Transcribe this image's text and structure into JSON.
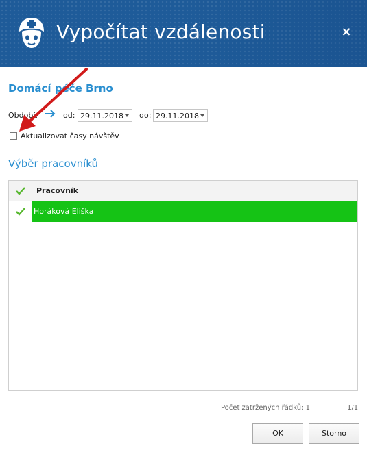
{
  "window": {
    "title": "Vypočítat vzdálenosti",
    "close_glyph": "×"
  },
  "organization": "Domácí péče Brno",
  "period": {
    "label": "Období:",
    "from_label": "od:",
    "from_value": "29.11.2018",
    "to_label": "do:",
    "to_value": "29.11.2018"
  },
  "update_visits": {
    "label": "Aktualizovat časy návštěv",
    "checked": false
  },
  "workers": {
    "section_title": "Výběr pracovníků",
    "column_header": "Pracovník",
    "rows": [
      {
        "name": "Horáková Eliška",
        "checked": true
      }
    ]
  },
  "footer": {
    "checked_rows": "Počet zatržených řádků: 1",
    "page": "1/1"
  },
  "buttons": {
    "ok": "OK",
    "cancel": "Storno"
  },
  "colors": {
    "header_bg": "#1e5b99",
    "accent": "#2a8fd0",
    "selected_row": "#15c315",
    "check": "#58b830",
    "annotation_arrow": "#d11a1a"
  },
  "icons": {
    "app": "nurse-icon",
    "period_arrow": "arrow-right-icon",
    "dropdown": "chevron-down-icon",
    "check": "checkmark-icon"
  }
}
